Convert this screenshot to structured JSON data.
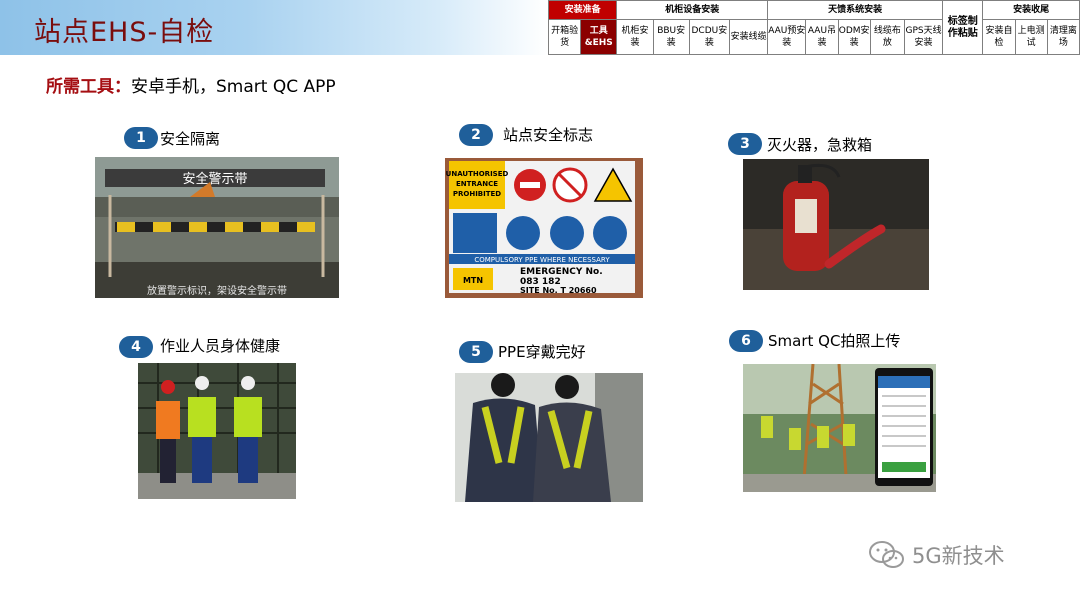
{
  "slide": {
    "title": "站点EHS-自检",
    "tools_label": "所需工具：",
    "tools_value": "安卓手机，Smart QC APP"
  },
  "progress_nav": {
    "groups": [
      "安装准备",
      "机柜设备安装",
      "天馈系统安装",
      "安装收尾"
    ],
    "standalone": "标签制作粘贴",
    "steps": [
      {
        "label": "开箱验货",
        "active": false
      },
      {
        "label": "工具&EHS",
        "active": true
      },
      {
        "label": "机柜安装",
        "active": false
      },
      {
        "label": "BBU安装",
        "active": false
      },
      {
        "label": "DCDU安装",
        "active": false
      },
      {
        "label": "安装线缆",
        "active": false
      },
      {
        "label": "AAU预安装",
        "active": false
      },
      {
        "label": "AAU吊装",
        "active": false
      },
      {
        "label": "ODM安装",
        "active": false
      },
      {
        "label": "线缆布放",
        "active": false
      },
      {
        "label": "GPS天线安装",
        "active": false
      },
      {
        "label": "安装自检",
        "active": false
      },
      {
        "label": "上电测试",
        "active": false
      },
      {
        "label": "清理离场",
        "active": false
      }
    ]
  },
  "items": [
    {
      "num": "1",
      "caption": "安全隔离",
      "photo_text": [
        "安全警示带",
        "放置警示标识，架设安全警示带"
      ]
    },
    {
      "num": "2",
      "caption": "站点安全标志",
      "photo_text": [
        "UNAUTHORISED",
        "ENTRANCE",
        "PROHIBITED",
        "COMPULSORY PPE WHERE NECESSARY",
        "EMERGENCY No.",
        "083 182",
        "SITE No. T 20660",
        "MTN"
      ]
    },
    {
      "num": "3",
      "caption": "灭火器，急救箱",
      "photo_text": []
    },
    {
      "num": "4",
      "caption": "作业人员身体健康",
      "photo_text": []
    },
    {
      "num": "5",
      "caption": "PPE穿戴完好",
      "photo_text": []
    },
    {
      "num": "6",
      "caption": "Smart QC拍照上传",
      "photo_text": []
    }
  ],
  "watermark": {
    "text": "5G新技术",
    "icon": "wechat-icon"
  },
  "colors": {
    "title": "#7a0d0d",
    "badge": "#1f5f9a",
    "active_step": "#8b0000",
    "header_band": "#8ec2e8"
  }
}
